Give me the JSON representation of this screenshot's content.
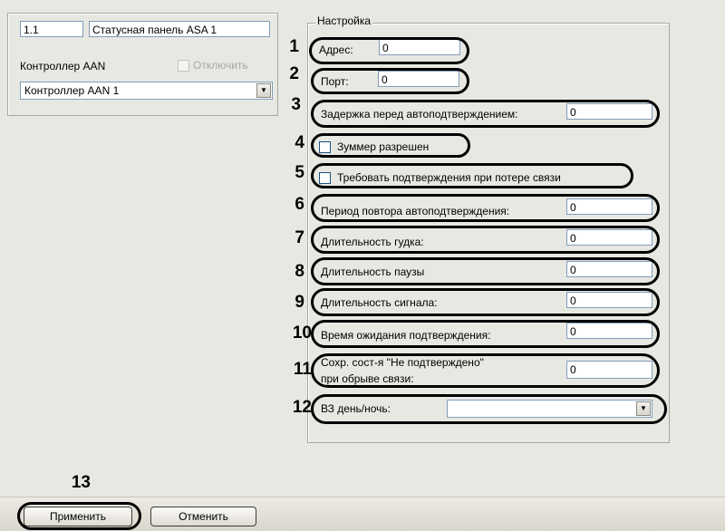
{
  "left_panel": {
    "id_value": "1.1",
    "name_value": "Статусная панель ASA 1",
    "controller_label": "Контроллер AAN",
    "disable_label": "Отключить",
    "controller_select_value": "Контроллер AAN 1"
  },
  "settings": {
    "group_title": "Настройка",
    "fields": [
      {
        "num": "1",
        "label": "Адрес:",
        "value": "0"
      },
      {
        "num": "2",
        "label": "Порт:",
        "value": "0"
      },
      {
        "num": "3",
        "label": "Задержка перед автоподтверждением:",
        "value": "0"
      },
      {
        "num": "4",
        "label": "Зуммер разрешен"
      },
      {
        "num": "5",
        "label": "Требовать подтверждения при потере связи"
      },
      {
        "num": "6",
        "label": "Период повтора автоподтверждения:",
        "value": "0"
      },
      {
        "num": "7",
        "label": "Длительность гудка:",
        "value": "0"
      },
      {
        "num": "8",
        "label": "Длительность паузы",
        "value": "0"
      },
      {
        "num": "9",
        "label": "Длительность сигнала:",
        "value": "0"
      },
      {
        "num": "10",
        "label": "Время ожидания подтверждения:",
        "value": "0"
      },
      {
        "num": "11",
        "label_line1": "Сохр. сост-я \"Не подтверждено\"",
        "label_line2": "при обрыве связи:",
        "value": "0"
      },
      {
        "num": "12",
        "label": "ВЗ день/ночь:",
        "value": ""
      }
    ]
  },
  "footer": {
    "num": "13",
    "apply_label": "Применить",
    "cancel_label": "Отменить"
  }
}
